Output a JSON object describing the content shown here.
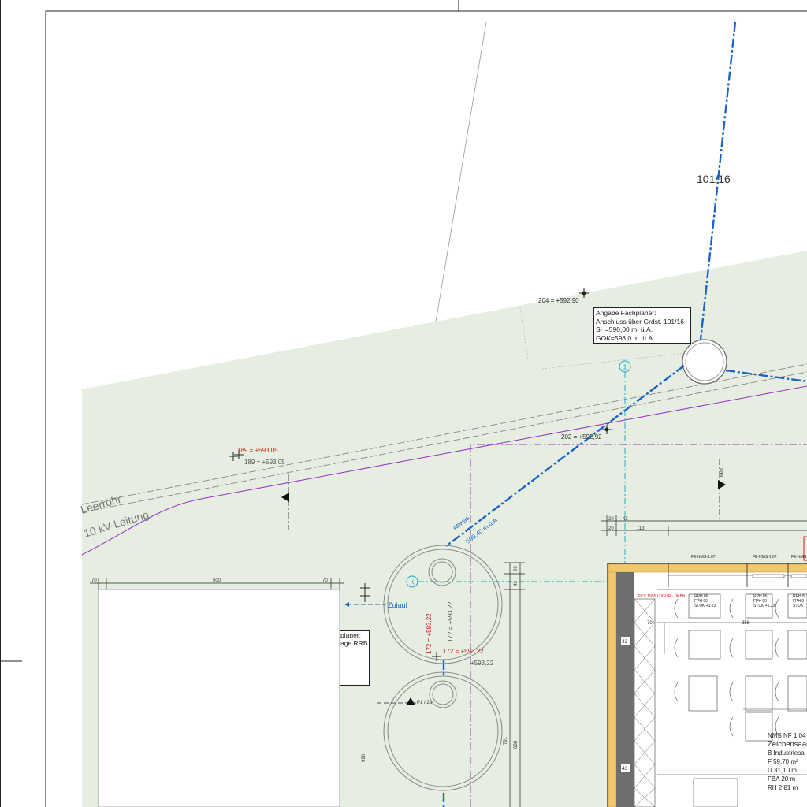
{
  "parcel": {
    "label": "101/16"
  },
  "cables": {
    "leerrohr": "Leerrohr",
    "kv": "10 kV-Leitung"
  },
  "elevations": {
    "top": "204 = +592,90",
    "mid": "202 = +592,92",
    "left_red": "189 = +593,05",
    "left_grey": "189 = +593,05",
    "tank_red_v": "172 = +593,22",
    "tank_grey_v": "172 = +593,22",
    "tank_red_h": "172 = +593,22",
    "tank_grey_h": "+593,22"
  },
  "note": {
    "lines": [
      "Angabe Fachplaner:",
      "Anschluss über Grdst. 101/16",
      "SH=590,00 m. ü.A.",
      "GOK=593,0 m. ü.A."
    ]
  },
  "side_note": {
    "lines": [
      "planer:",
      "age RRB"
    ]
  },
  "pipe": {
    "label_a": "Abwas",
    "label_b": "590,40 m.ü.A",
    "zulauf": "Zulauf"
  },
  "markers": {
    "axis": "1",
    "tank": "K",
    "point": "P1 / 2a",
    "section": "NMS"
  },
  "dims": {
    "d1": "20",
    "d2": "43",
    "d3": "20",
    "d4": "113",
    "d5": "70",
    "d6": "500",
    "d7": "70",
    "d8": "20",
    "d9": "43",
    "d10": "791",
    "d11": "688",
    "d12": "70",
    "d13": "356",
    "d14": "43",
    "d15": "43",
    "d16": "990"
  },
  "building": {
    "tags": [
      "FE-NMS-1.07",
      "FE-NMS-1.07",
      "FE-NMS"
    ],
    "room_labels": [
      "RPH 86",
      "RPH 85",
      "RPH 8"
    ],
    "room_sub": [
      "FPH 90",
      "FPH 90",
      "FPH 9"
    ],
    "room_stuk": [
      "STUK +1.23",
      "STUK +1.23",
      "STUK"
    ],
    "red_tag": "FKS 1905 / DGUR - ÜKBN"
  },
  "info": {
    "code": "NMS NF 1.04",
    "title": "Zeichensaal",
    "lines": [
      "B Industriesa",
      "F  59,70 m²",
      "U  31,10 m",
      "FBA 20 m",
      "RH 2,81 m"
    ]
  },
  "colors": {
    "green": "#e5eee0",
    "blue": "#1e64c8",
    "magenta": "#9b30c9",
    "cyan": "#1aa3c2",
    "red": "#cc2020"
  }
}
